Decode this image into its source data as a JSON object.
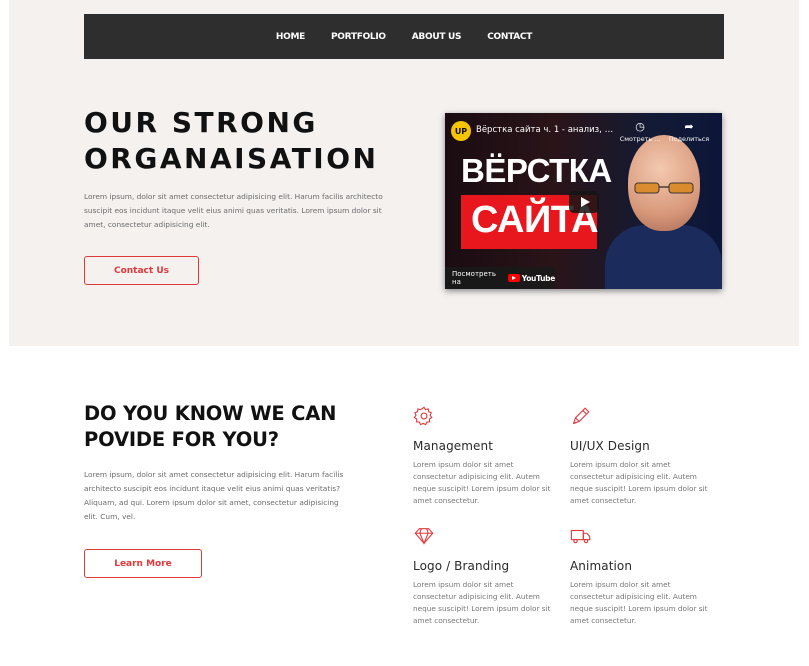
{
  "nav": {
    "items": [
      "HOME",
      "PORTFOLIO",
      "ABOUT US",
      "CONTACT"
    ]
  },
  "hero": {
    "title_line1": "OUR STRONG",
    "title_line2": "ORGANAISATION",
    "text": "Lorem ipsum, dolor sit amet consectetur adipisicing elit. Harum facilis architecto suscipit eos incidunt itaque velit eius animi quas veritatis. Lorem ipsum dolor sit amet, consectetur adipisicing elit.",
    "button_label": "Contact Us"
  },
  "video": {
    "channel_logo": "UP",
    "title": "Вёрстка сайта ч. 1 - анализ, вё...",
    "watch_later": "Смотреть ...",
    "share": "Поделиться",
    "thumb_word1": "ВЁРСТКА",
    "thumb_word2": "САЙТА",
    "watch_on": "Посмотреть на",
    "youtube": "YouTube"
  },
  "services": {
    "title_line1": "DO YOU KNOW WE CAN",
    "title_line2": "POVIDE FOR YOU?",
    "text": "Lorem ipsum, dolor sit amet consectetur adipisicing elit. Harum facilis architecto suscipit eos incidunt itaque velit eius animi quas veritatis? Aliquam, ad qui. Lorem ipsum dolor sit amet, consectetur adipisicing elit. Cum, vel.",
    "button_label": "Learn More",
    "features": [
      {
        "icon": "gear-icon",
        "name": "Management",
        "desc": "Lorem ipsum dolor sit amet consectetur adipisicing elit. Autem neque suscipit! Lorem ipsum dolor sit amet consectetur."
      },
      {
        "icon": "pencil-icon",
        "name": "UI/UX Design",
        "desc": "Lorem ipsum dolor sit amet consectetur adipisicing elit. Autem neque suscipit! Lorem ipsum dolor sit amet consectetur."
      },
      {
        "icon": "diamond-icon",
        "name": "Logo / Branding",
        "desc": "Lorem ipsum dolor sit amet consectetur adipisicing elit. Autem neque suscipit! Lorem ipsum dolor sit amet consectetur."
      },
      {
        "icon": "truck-icon",
        "name": "Animation",
        "desc": "Lorem ipsum dolor sit amet consectetur adipisicing elit. Autem neque suscipit! Lorem ipsum dolor sit amet consectetur."
      }
    ]
  },
  "colors": {
    "accent": "#e0393c",
    "nav_bg": "#2e2e2e",
    "hero_bg": "#f4f1ef"
  }
}
